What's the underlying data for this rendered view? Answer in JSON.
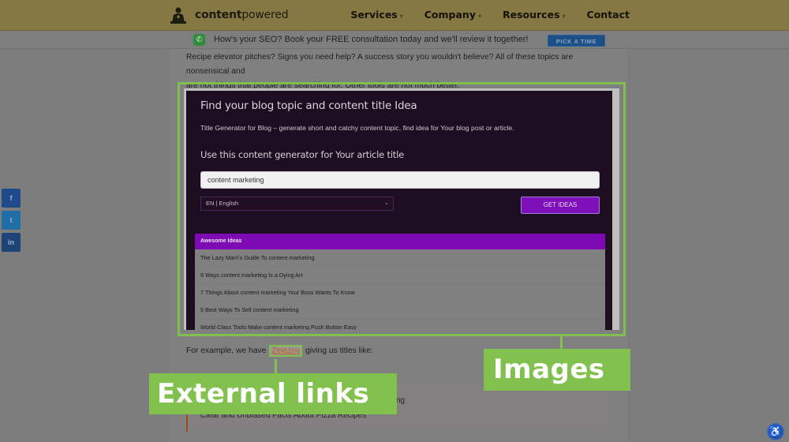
{
  "header": {
    "logo_bold": "content",
    "logo_light": "powered",
    "nav": [
      {
        "label": "Services",
        "has_dropdown": true
      },
      {
        "label": "Company",
        "has_dropdown": true
      },
      {
        "label": "Resources",
        "has_dropdown": true
      },
      {
        "label": "Contact",
        "has_dropdown": false
      }
    ],
    "caret": "⌄"
  },
  "promo": {
    "icon": "phone-icon",
    "text": "How's your SEO? Book your FREE consultation today and we'll review it together!",
    "button_label": "PICK A TIME"
  },
  "article": {
    "intro_line1": "Recipe elevator pitches? Signs you need help? A success story you wouldn't believe? All of these topics are nonsensical and",
    "intro_line2": "are not things that people are searching for. Other tools are not much better.",
    "example_before": "For example, we have ",
    "example_link": "Zelezny",
    "example_after": " giving us titles like:",
    "quote_line1_tail": "ng",
    "quote_line2": "Clear and Unbiased Facts About Pizza Recipes"
  },
  "screenshot_tool": {
    "title": "Find your blog topic and content title Idea",
    "subtitle": "Title Generator for Blog – generate short and catchy content topic, find idea for Your blog post or article.",
    "heading": "Use this content generator for Your article title",
    "input_value": "content marketing",
    "language_select": "EN | English",
    "button_label": "GET IDEAS",
    "ideas_header": "Awesome Ideas",
    "ideas": [
      "The Lazy Man\\'s Guide To content marketing",
      "9 Ways content marketing Is a Dying Art",
      "7 Things About content marketing Your Boss Wants To Know",
      "5 Best Ways To Sell content marketing",
      "World Class Tools Make content marketing Push Button Easy"
    ]
  },
  "callouts": {
    "external_links": "External links",
    "images": "Images"
  },
  "share": [
    {
      "icon": "facebook-icon",
      "glyph": "f"
    },
    {
      "icon": "twitter-icon",
      "glyph": "t"
    },
    {
      "icon": "linkedin-icon",
      "glyph": "in"
    }
  ],
  "accessibility": {
    "glyph": "♿"
  },
  "colors": {
    "header_bg": "#867843",
    "callout_green": "#82c14e",
    "tool_bg": "#1c0d20",
    "tool_purple": "#7e0ab6",
    "link_orange": "#c55d13"
  }
}
